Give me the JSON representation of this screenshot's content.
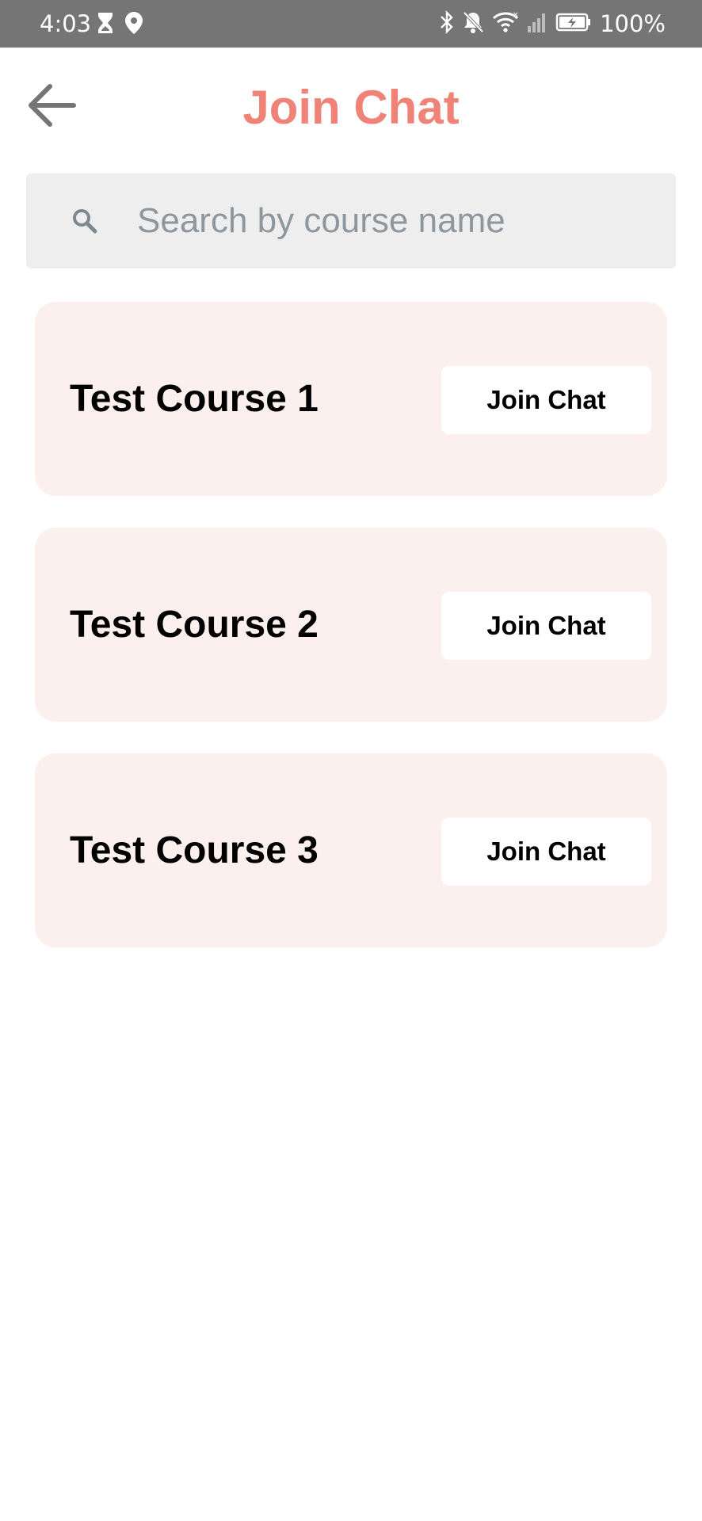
{
  "status_bar": {
    "time": "4:03",
    "battery": "100%",
    "left_icons": [
      "hourglass-icon",
      "location-pin-icon"
    ],
    "right_icons": [
      "bluetooth-icon",
      "bell-off-icon",
      "wifi-icon",
      "signal-icon",
      "battery-icon"
    ]
  },
  "header": {
    "title": "Join Chat",
    "back_icon": "arrow-left-icon"
  },
  "search": {
    "placeholder": "Search by course name",
    "value": "",
    "icon": "search-icon"
  },
  "courses": [
    {
      "name": "Test Course 1",
      "button_label": "Join Chat"
    },
    {
      "name": "Test Course 2",
      "button_label": "Join Chat"
    },
    {
      "name": "Test Course 3",
      "button_label": "Join Chat"
    }
  ],
  "colors": {
    "status_bar": "#757575",
    "accent": "#ef8378",
    "card_background": "#fcf0ee",
    "search_background": "#eeeeee",
    "placeholder": "#8e969e"
  }
}
